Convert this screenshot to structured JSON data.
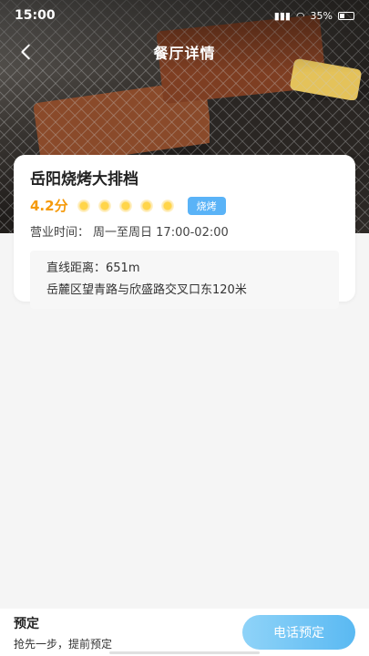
{
  "status_bar": {
    "time": "15:00",
    "battery": "35%"
  },
  "nav": {
    "title": "餐厅详情",
    "back_icon": "chevron-left-icon"
  },
  "restaurant": {
    "name": "岳阳烧烤大排档",
    "score": "4.2分",
    "rating": 4.2,
    "rating_max": 5,
    "tag": "烧烤",
    "hours_label": "营业时间：",
    "hours_value": "周一至周日 17:00-02:00",
    "distance": "直线距离：651m",
    "address": "岳麓区望青路与欣盛路交叉口东120米"
  },
  "bottom_bar": {
    "heading": "预定",
    "subtext": "抢先一步，提前预定",
    "call_button": "电话预定"
  },
  "colors": {
    "accent": "#5ab3f7",
    "score": "#f59a0b"
  }
}
